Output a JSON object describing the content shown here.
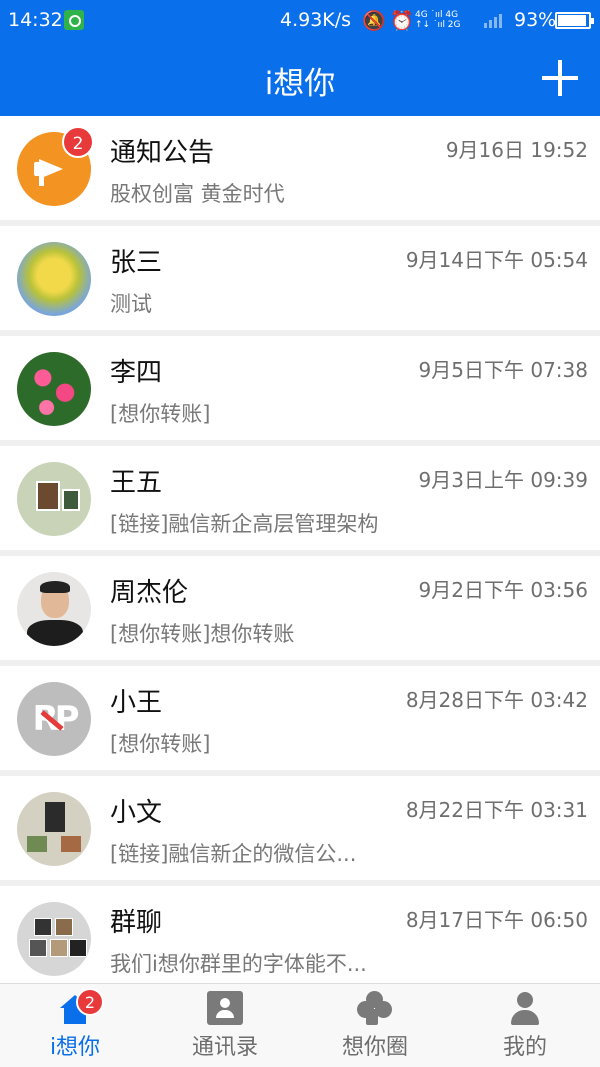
{
  "status_bar": {
    "time": "14:32",
    "net_speed": "4.93K/s",
    "network_top": "4G ˙ııl 4G",
    "network_bottom": "↑↓ ˙ııl 2G",
    "battery_percent": "93%",
    "battery_level": 0.93,
    "icons": [
      "sync-icon",
      "mute-bell-icon",
      "alarm-icon",
      "signal-icon",
      "battery-icon"
    ]
  },
  "header": {
    "title": "i想你",
    "add_icon": "plus-icon"
  },
  "conversations": [
    {
      "name": "通知公告",
      "time": "9月16日 19:52",
      "preview": "股权创富 黄金时代",
      "badge": "2",
      "avatar": "megaphone-icon"
    },
    {
      "name": "张三",
      "time": "9月14日下午 05:54",
      "preview": "测试",
      "avatar": "photo"
    },
    {
      "name": "李四",
      "time": "9月5日下午 07:38",
      "preview": "[想你转账]",
      "avatar": "photo"
    },
    {
      "name": "王五",
      "time": "9月3日上午 09:39",
      "preview": "[链接]融信新企高层管理架构",
      "avatar": "photo"
    },
    {
      "name": "周杰伦",
      "time": "9月2日下午 03:56",
      "preview": "[想你转账]想你转账",
      "avatar": "photo"
    },
    {
      "name": "小王",
      "time": "8月28日下午 03:42",
      "preview": "[想你转账]",
      "avatar": "photo"
    },
    {
      "name": "小文",
      "time": "8月22日下午 03:31",
      "preview": "[链接]融信新企的微信公...",
      "avatar": "photo"
    },
    {
      "name": "群聊",
      "time": "8月17日下午 06:50",
      "preview": "我们i想你群里的字体能不...",
      "avatar": "group-photo"
    }
  ],
  "bottom_nav": [
    {
      "label": "i想你",
      "icon": "home-icon",
      "active": true,
      "badge": "2"
    },
    {
      "label": "通讯录",
      "icon": "contacts-book-icon",
      "active": false
    },
    {
      "label": "想你圈",
      "icon": "clover-icon",
      "active": false
    },
    {
      "label": "我的",
      "icon": "person-icon",
      "active": false
    }
  ],
  "colors": {
    "brand_blue": "#0a6fea",
    "badge_red": "#e83a3a",
    "notice_orange": "#f39321"
  }
}
